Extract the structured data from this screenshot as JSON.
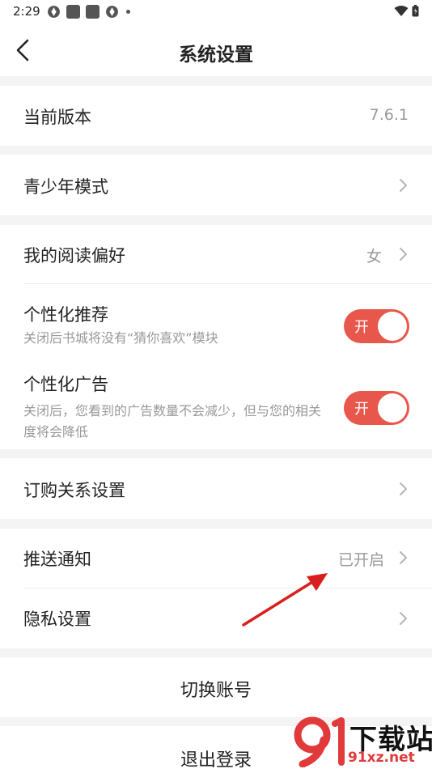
{
  "status_bar": {
    "time": "2:29"
  },
  "header": {
    "title": "系统设置"
  },
  "settings": {
    "version": {
      "label": "当前版本",
      "value": "7.6.1"
    },
    "youth_mode": {
      "label": "青少年模式"
    },
    "reading_pref": {
      "label": "我的阅读偏好",
      "value": "女"
    },
    "personal_rec": {
      "label": "个性化推荐",
      "desc": "关闭后书城将没有“猜你喜欢”模块",
      "toggle_text": "开",
      "on": true
    },
    "personal_ads": {
      "label": "个性化广告",
      "desc": "关闭后，您看到的广告数量不会减少，但与您的相关度将会降低",
      "toggle_text": "开",
      "on": true
    },
    "subscription": {
      "label": "订购关系设置"
    },
    "push": {
      "label": "推送通知",
      "value": "已开启"
    },
    "privacy": {
      "label": "隐私设置"
    }
  },
  "actions": {
    "switch_account": "切换账号",
    "logout": "退出登录"
  },
  "watermark": {
    "brand": "下载站",
    "domain": "91xz.net"
  },
  "colors": {
    "accent": "#e8574c",
    "background": "#f4f4f4",
    "annotation_arrow": "#d91e1e"
  }
}
